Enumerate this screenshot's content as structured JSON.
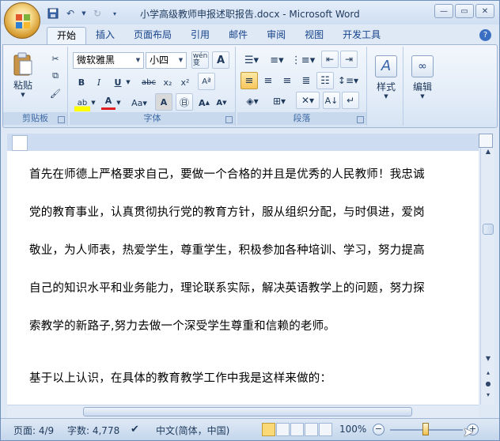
{
  "window": {
    "title": "小学高级教师申报述职报告.docx - Microsoft Word"
  },
  "tabs": [
    {
      "label": "开始",
      "active": true
    },
    {
      "label": "插入"
    },
    {
      "label": "页面布局"
    },
    {
      "label": "引用"
    },
    {
      "label": "邮件"
    },
    {
      "label": "审阅"
    },
    {
      "label": "视图"
    },
    {
      "label": "开发工具"
    }
  ],
  "ribbon": {
    "clipboard": {
      "label": "剪贴板",
      "paste_label": "粘贴"
    },
    "font": {
      "label": "字体",
      "font_name": "微软雅黑",
      "font_size": "小四",
      "wen_label": "wén\n变"
    },
    "paragraph": {
      "label": "段落"
    },
    "styles": {
      "label": "样式"
    },
    "editing": {
      "label": "编辑"
    }
  },
  "document": {
    "lines": [
      "首先在师德上严格要求自己，要做一个合格的并且是优秀的人民教师！我忠诚",
      "党的教育事业，认真贯彻执行党的教育方针，服从组织分配，与时俱进，爱岗",
      "敬业，为人师表，热爱学生，尊重学生，积极参加各种培训、学习，努力提高",
      "自己的知识水平和业务能力，理论联系实际，解决英语教学上的问题，努力探",
      "索教学的新路子,努力去做一个深受学生尊重和信赖的老师。",
      "基于以上认识，在具体的教育教学工作中我是这样来做的："
    ]
  },
  "status": {
    "page": "页面: 4/9",
    "words": "字数: 4,778",
    "language": "中文(简体，中国)",
    "zoom": "100%"
  },
  "colors": {
    "accent": "#15428b",
    "ribbon_bg": "#dfe9f5"
  }
}
